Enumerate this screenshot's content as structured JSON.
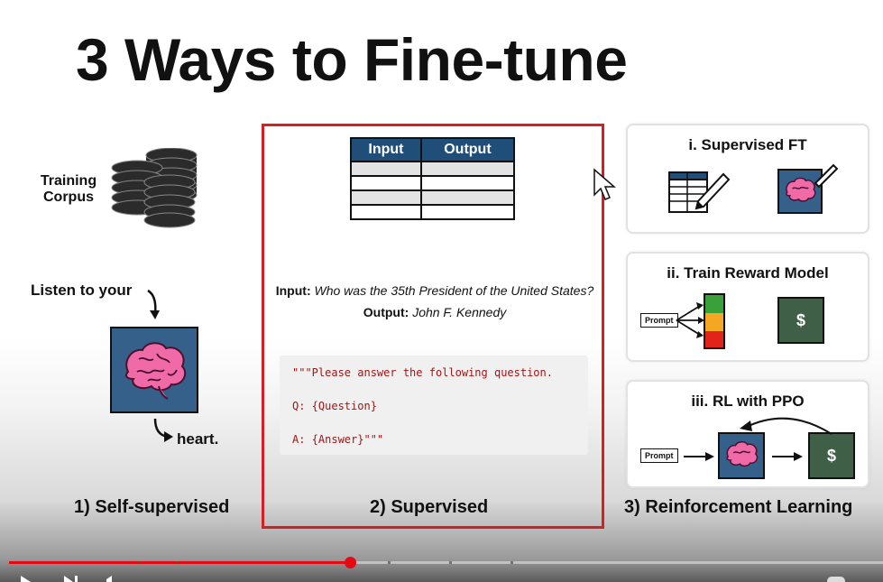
{
  "slide": {
    "title": "3 Ways to Fine-tune",
    "col1": {
      "corpus_label": "Training Corpus",
      "listen": "Listen to your",
      "heart": "heart.",
      "label": "1) Self-supervised"
    },
    "col2": {
      "table_headers": [
        "Input",
        "Output"
      ],
      "input_label": "Input:",
      "input_text": "Who was the 35th President of the United States?",
      "output_label": "Output:",
      "output_text": "John F. Kennedy",
      "code_lines": [
        "\"\"\"Please answer the following question.",
        "Q: {Question}",
        "A: {Answer}\"\"\""
      ],
      "label": "2) Supervised"
    },
    "col3": {
      "panel1_title": "i. Supervised FT",
      "panel2_title": "ii. Train Reward Model",
      "panel2_prompt": "Prompt",
      "panel2_dollar": "$",
      "panel3_title": "iii. RL with PPO",
      "panel3_prompt": "Prompt",
      "panel3_dollar": "$",
      "label": "3) Reinforcement Learning"
    }
  },
  "player": {
    "progress_fraction": 0.39,
    "accent": "#e50914"
  },
  "colors": {
    "frame_red": "#d51f25",
    "table_header": "#1f4e79",
    "brain_box": "#356089",
    "reward_box": "#3f5f46"
  }
}
